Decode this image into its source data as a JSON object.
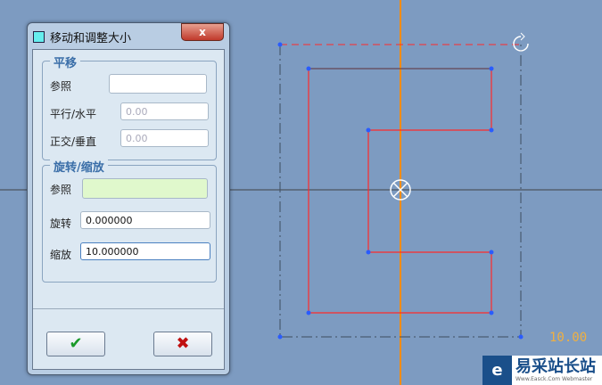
{
  "dialog": {
    "title": "移动和调整大小",
    "close_label": "x",
    "translate": {
      "legend": "平移",
      "ref_label": "参照",
      "ref_value": "",
      "horizontal_label": "平行/水平",
      "horizontal_value": "0.00",
      "vertical_label": "正交/垂直",
      "vertical_value": "0.00"
    },
    "rotate_scale": {
      "legend": "旋转/缩放",
      "ref_label": "参照",
      "ref_value": "",
      "rotate_label": "旋转",
      "rotate_value": "0.000000",
      "scale_label": "缩放",
      "scale_value": "10.000000"
    },
    "ok_label": "✔",
    "cancel_label": "✖"
  },
  "canvas": {
    "scale_readout": "10.00",
    "colors": {
      "background": "#7d9bc1",
      "sketch": "#ff2a2a",
      "axis": "#ff8c00"
    }
  },
  "watermark": {
    "logo": "e",
    "name": "易采站长站",
    "url": "Www.Easck.Com Webmaster"
  }
}
